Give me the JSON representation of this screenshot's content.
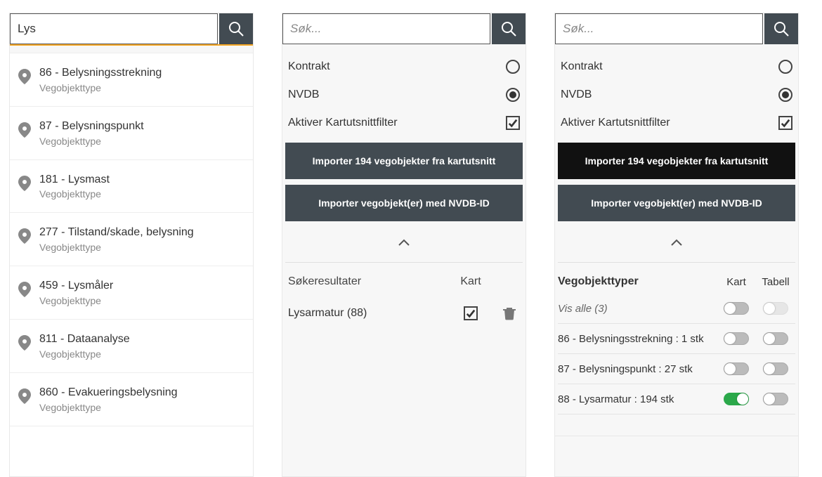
{
  "panel1": {
    "search_value": "Lys",
    "placeholder": "",
    "items": [
      {
        "title": "86 - Belysningsstrekning",
        "sub": "Vegobjekttype"
      },
      {
        "title": "87 - Belysningspunkt",
        "sub": "Vegobjekttype"
      },
      {
        "title": "181 - Lysmast",
        "sub": "Vegobjekttype"
      },
      {
        "title": "277 - Tilstand/skade, belysning",
        "sub": "Vegobjekttype"
      },
      {
        "title": "459 - Lysmåler",
        "sub": "Vegobjekttype"
      },
      {
        "title": "811 - Dataanalyse",
        "sub": "Vegobjekttype"
      },
      {
        "title": "860 - Evakueringsbelysning",
        "sub": "Vegobjekttype"
      }
    ]
  },
  "filters": {
    "placeholder": "Søk...",
    "kontrakt_label": "Kontrakt",
    "nvdb_label": "NVDB",
    "aktiver_label": "Aktiver Kartutsnittfilter",
    "btn_import_map": "Importer 194 vegobjekter fra kartutsnitt",
    "btn_import_nvdbid": "Importer vegobjekt(er) med NVDB-ID"
  },
  "panel2": {
    "results_header_1": "Søkeresultater",
    "results_header_2": "Kart",
    "result_label": "Lysarmatur (88)"
  },
  "panel3": {
    "header_title": "Vegobjekttyper",
    "header_kart": "Kart",
    "header_tabell": "Tabell",
    "vis_alle": "Vis alle (3)",
    "rows": [
      {
        "label": "86 - Belysningsstrekning : 1 stk",
        "kart_on": false,
        "tabell_on": false
      },
      {
        "label": "87 - Belysningspunkt : 27 stk",
        "kart_on": false,
        "tabell_on": false
      },
      {
        "label": "88 - Lysarmatur : 194 stk",
        "kart_on": true,
        "tabell_on": false
      }
    ]
  }
}
